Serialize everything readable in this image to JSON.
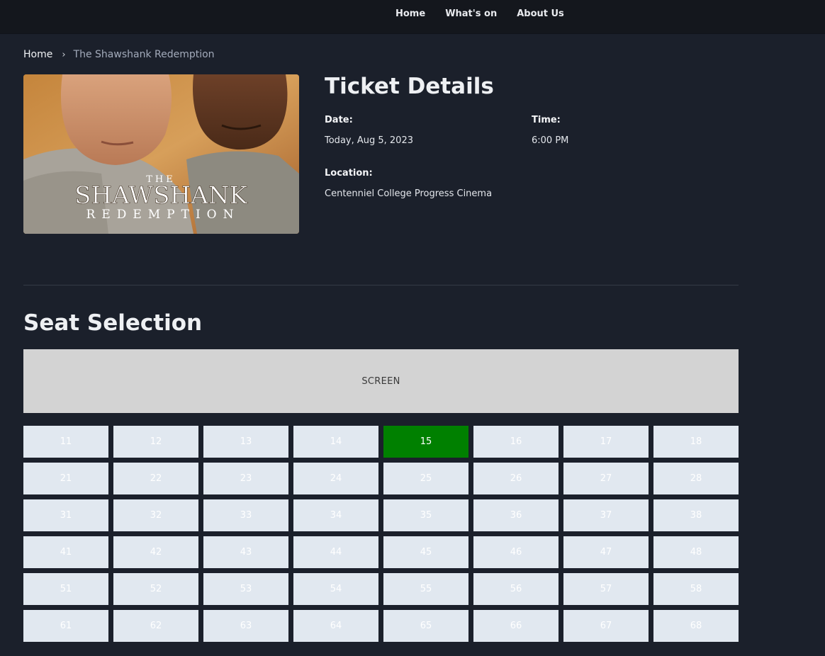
{
  "nav": {
    "items": [
      {
        "label": "Home"
      },
      {
        "label": "What's on"
      },
      {
        "label": "About Us"
      }
    ]
  },
  "breadcrumb": {
    "home": "Home",
    "separator": "›",
    "current": "The Shawshank Redemption"
  },
  "poster": {
    "title_small": "THE",
    "title_main": "SHAWSHANK",
    "title_sub": "REDEMPTION"
  },
  "ticket": {
    "title": "Ticket Details",
    "date_label": "Date:",
    "date_value": "Today, Aug 5, 2023",
    "time_label": "Time:",
    "time_value": "6:00 PM",
    "location_label": "Location:",
    "location_value": "Centenniel College Progress Cinema"
  },
  "seat_selection": {
    "title": "Seat Selection",
    "screen_label": "SCREEN",
    "selected_seat": "15",
    "rows": [
      [
        "11",
        "12",
        "13",
        "14",
        "15",
        "16",
        "17",
        "18"
      ],
      [
        "21",
        "22",
        "23",
        "24",
        "25",
        "26",
        "27",
        "28"
      ],
      [
        "31",
        "32",
        "33",
        "34",
        "35",
        "36",
        "37",
        "38"
      ],
      [
        "41",
        "42",
        "43",
        "44",
        "45",
        "46",
        "47",
        "48"
      ],
      [
        "51",
        "52",
        "53",
        "54",
        "55",
        "56",
        "57",
        "58"
      ],
      [
        "61",
        "62",
        "63",
        "64",
        "65",
        "66",
        "67",
        "68"
      ]
    ]
  },
  "colors": {
    "background": "#1b202b",
    "topbar": "#14171d",
    "seat_available": "#e1e8f0",
    "seat_selected": "#008000",
    "screen": "#d3d3d3"
  }
}
